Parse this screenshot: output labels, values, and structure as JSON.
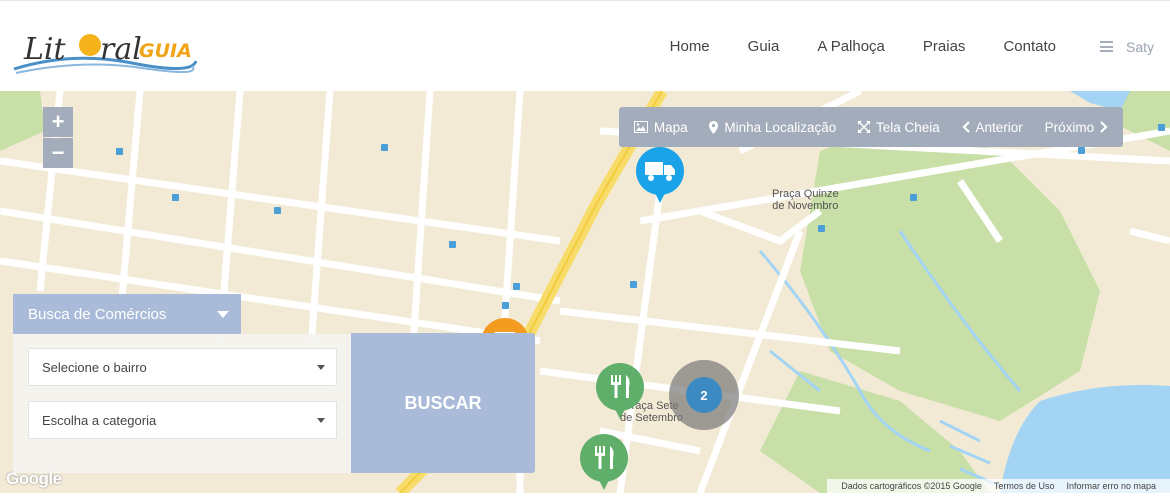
{
  "header": {
    "logo_text": "LitoralGUIA",
    "nav": [
      "Home",
      "Guia",
      "A Palhoça",
      "Praias",
      "Contato"
    ],
    "user_name": "Saty"
  },
  "map": {
    "zoom_in": "+",
    "zoom_out": "−",
    "toolbar": {
      "mapa": "Mapa",
      "localizacao": "Minha Localização",
      "tela_cheia": "Tela Cheia",
      "anterior": "Anterior",
      "proximo": "Próximo"
    },
    "labels": {
      "praca_quinze_1": "Praça Quinze",
      "praca_quinze_2": "de Novembro",
      "praca_sete_1": "Praça Sete",
      "praca_sete_2": "de Setembro"
    },
    "cluster_count": "2",
    "google": "Google",
    "attribution": {
      "dados": "Dados cartográficos ©2015 Google",
      "termos": "Termos de Uso",
      "erro": "Informar erro no mapa"
    }
  },
  "search": {
    "title": "Busca de Comércios",
    "bairro_placeholder": "Selecione o bairro",
    "categoria_placeholder": "Escolha a categoria",
    "button": "BUSCAR"
  },
  "colors": {
    "accent": "#a9bbd9",
    "toolbar": "#a3acba",
    "marker_blue": "#1aa3e8",
    "marker_green": "#5fae6a",
    "marker_orange": "#f39c1f",
    "water": "#a3d4f3",
    "park": "#c8dfa8"
  }
}
